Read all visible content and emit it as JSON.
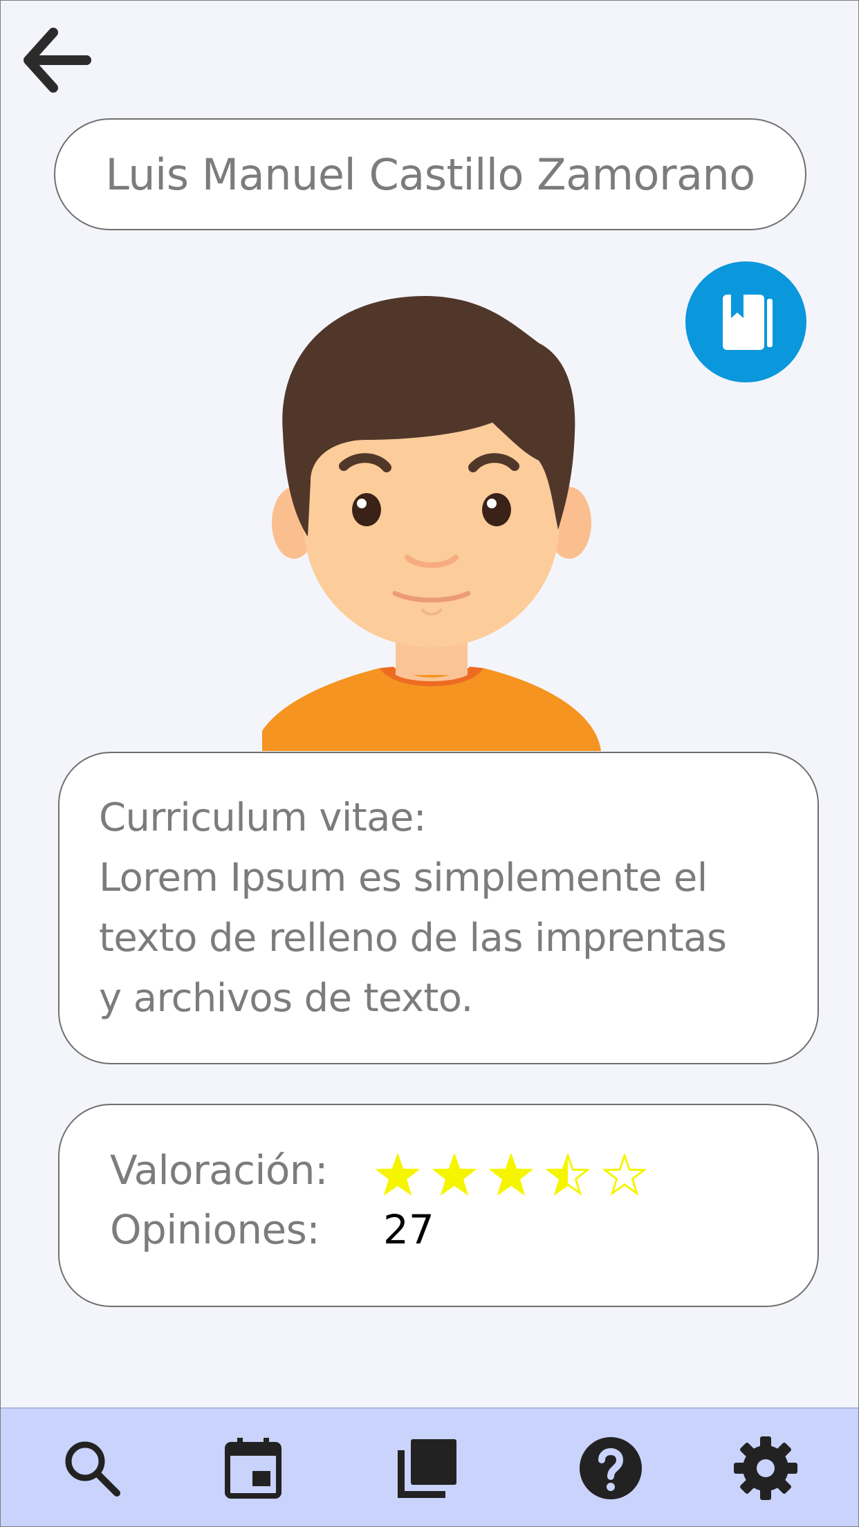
{
  "profile": {
    "name": "Luis Manuel Castillo Zamorano"
  },
  "cv": {
    "heading": "Curriculum vitae:",
    "line1": "Lorem Ipsum es simplemente el",
    "line2": "texto de relleno de las imprentas",
    "line3": "y archivos de texto."
  },
  "rating": {
    "label": "Valoración:",
    "value": 3.5,
    "max": 5,
    "star_color": "#f5f500"
  },
  "opinions": {
    "label": "Opiniones:",
    "count": "27"
  },
  "colors": {
    "background": "#f4f5fa",
    "accent": "#0a97dc",
    "nav_background": "#c9d3fb",
    "text_muted": "#7c7c7c"
  },
  "icons": {
    "back": "arrow-left-icon",
    "cv": "book-icon",
    "nav": [
      "search-icon",
      "calendar-icon",
      "library-icon",
      "help-icon",
      "gear-icon"
    ]
  }
}
